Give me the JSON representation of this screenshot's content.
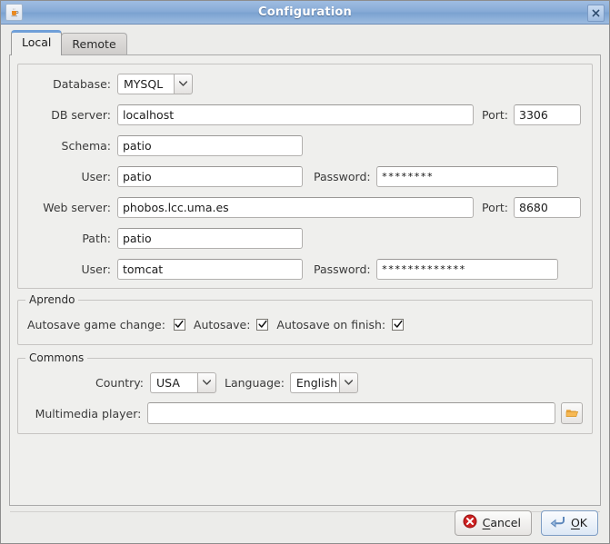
{
  "window": {
    "title": "Configuration",
    "app_icon": "java-coffee-cup-icon",
    "close_icon": "close-icon"
  },
  "tabs": [
    {
      "label": "Local",
      "active": true
    },
    {
      "label": "Remote",
      "active": false
    }
  ],
  "local": {
    "database": {
      "label": "Database:",
      "value": "MYSQL",
      "options": [
        "MYSQL"
      ]
    },
    "db_server": {
      "label": "DB server:",
      "value": "localhost",
      "port_label": "Port:",
      "port_value": "3306"
    },
    "schema": {
      "label": "Schema:",
      "value": "patio"
    },
    "db_user": {
      "label": "User:",
      "value": "patio",
      "password_label": "Password:",
      "password_value": "********"
    },
    "web_server": {
      "label": "Web server:",
      "value": "phobos.lcc.uma.es",
      "port_label": "Port:",
      "port_value": "8680"
    },
    "path": {
      "label": "Path:",
      "value": "patio"
    },
    "web_user": {
      "label": "User:",
      "value": "tomcat",
      "password_label": "Password:",
      "password_value": "*************"
    }
  },
  "aprendo": {
    "title": "Aprendo",
    "options": [
      {
        "label": "Autosave game change:",
        "checked": true
      },
      {
        "label": "Autosave:",
        "checked": true
      },
      {
        "label": "Autosave on finish:",
        "checked": true
      }
    ]
  },
  "commons": {
    "title": "Commons",
    "country": {
      "label": "Country:",
      "value": "USA",
      "options": [
        "USA"
      ]
    },
    "language": {
      "label": "Language:",
      "value": "English",
      "options": [
        "English"
      ]
    },
    "multimedia": {
      "label": "Multimedia player:",
      "value": "",
      "placeholder": "",
      "browse_icon": "folder-open-icon"
    }
  },
  "buttons": {
    "cancel": {
      "label": "Cancel",
      "mnemonic": "C",
      "icon": "cancel-circle-icon"
    },
    "ok": {
      "label": "OK",
      "mnemonic": "O",
      "icon": "enter-arrow-icon"
    }
  },
  "colors": {
    "titlebar_blue": "#86aad6",
    "panel_gray": "#efefed",
    "accent_tab": "#6f9fd8",
    "cancel_red": "#cc2222",
    "folder_orange": "#f0a023"
  }
}
